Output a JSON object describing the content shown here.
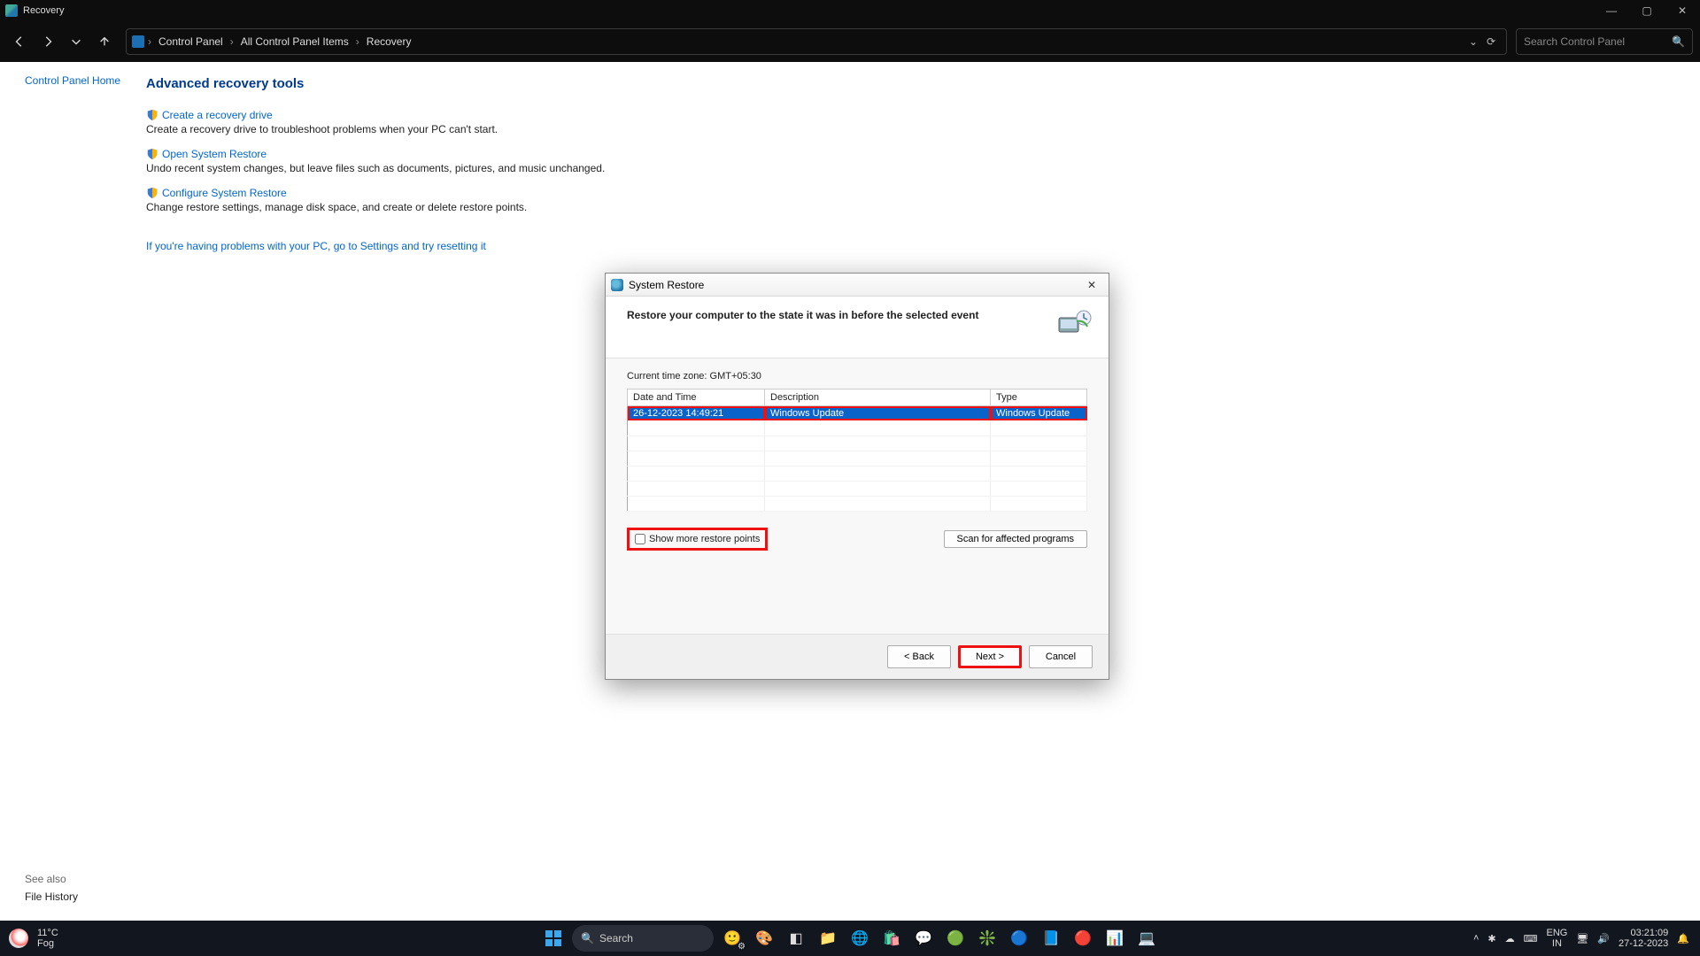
{
  "window": {
    "title": "Recovery"
  },
  "breadcrumb": {
    "root": "Control Panel",
    "mid": "All Control Panel Items",
    "leaf": "Recovery"
  },
  "search": {
    "placeholder": "Search Control Panel"
  },
  "sidebar": {
    "home": "Control Panel Home"
  },
  "page": {
    "heading": "Advanced recovery tools",
    "items": [
      {
        "link": "Create a recovery drive",
        "desc": "Create a recovery drive to troubleshoot problems when your PC can't start."
      },
      {
        "link": "Open System Restore",
        "desc": "Undo recent system changes, but leave files such as documents, pictures, and music unchanged."
      },
      {
        "link": "Configure System Restore",
        "desc": "Change restore settings, manage disk space, and create or delete restore points."
      }
    ],
    "settings_link": "If you're having problems with your PC, go to Settings and try resetting it"
  },
  "see_also": {
    "header": "See also",
    "link": "File History"
  },
  "dialog": {
    "title": "System Restore",
    "header": "Restore your computer to the state it was in before the selected event",
    "timezone": "Current time zone: GMT+05:30",
    "columns": {
      "c1": "Date and Time",
      "c2": "Description",
      "c3": "Type"
    },
    "row": {
      "date": "26-12-2023 14:49:21",
      "desc": "Windows Update",
      "type": "Windows Update"
    },
    "show_more": "Show more restore points",
    "scan": "Scan for affected programs",
    "back": "< Back",
    "next": "Next >",
    "cancel": "Cancel"
  },
  "taskbar": {
    "weather_temp": "11°C",
    "weather_cond": "Fog",
    "search": "Search",
    "lang_top": "ENG",
    "lang_bot": "IN",
    "time": "03:21:09",
    "date": "27-12-2023"
  }
}
